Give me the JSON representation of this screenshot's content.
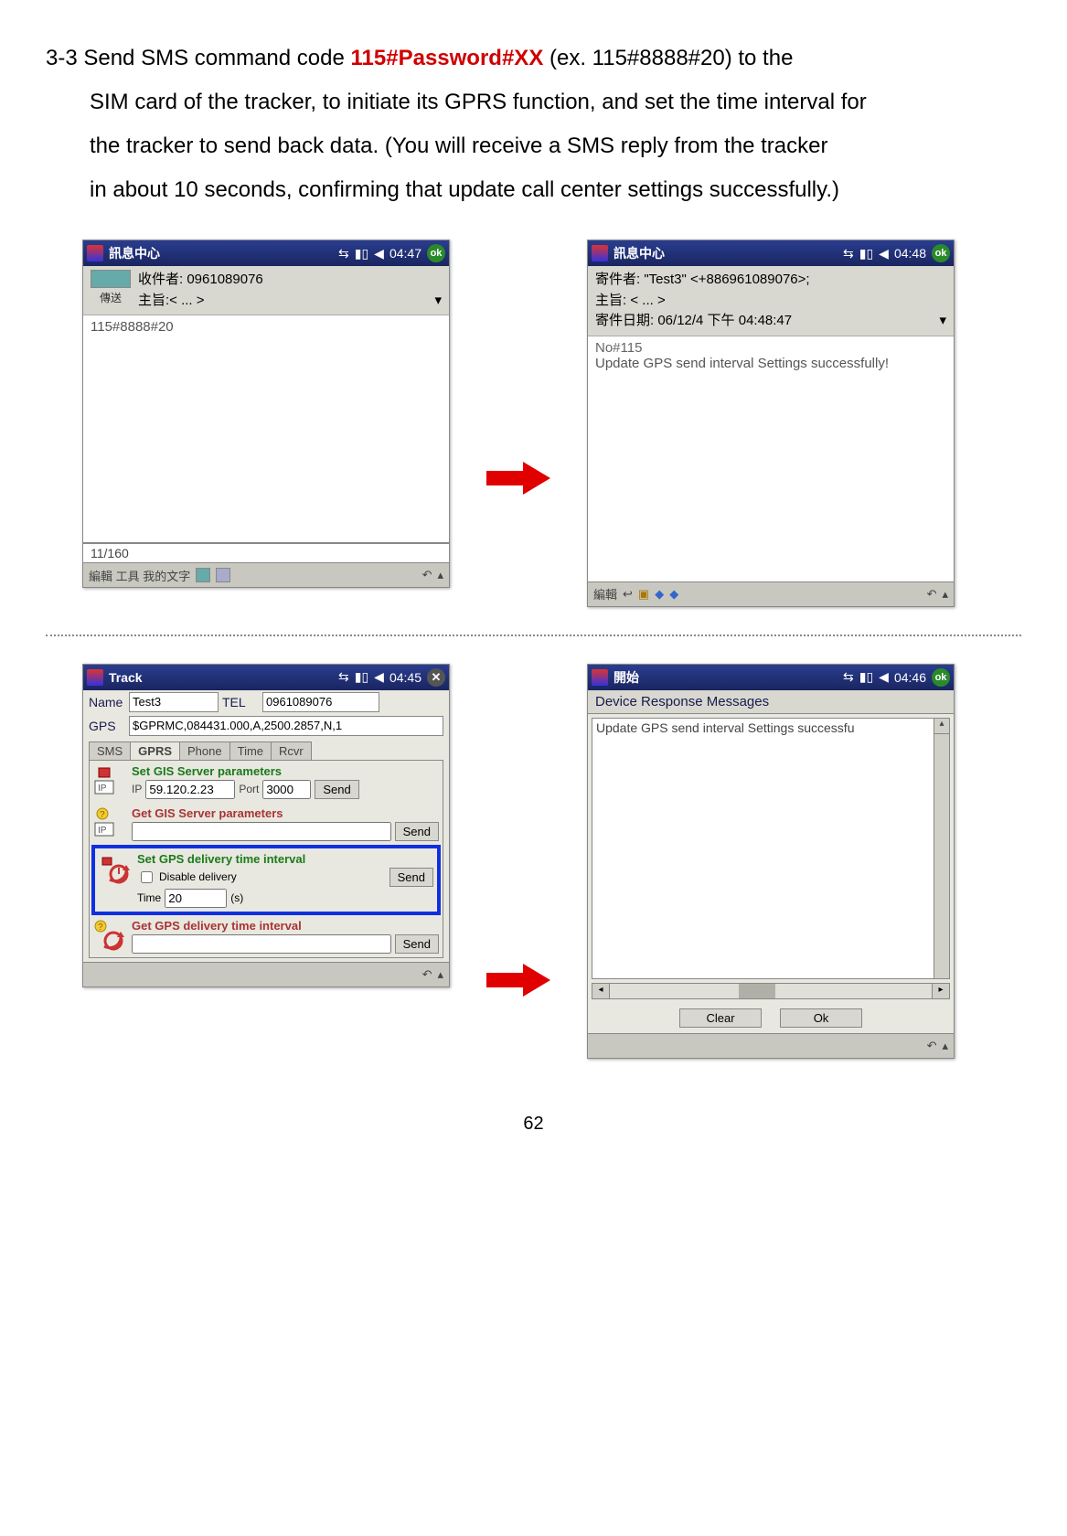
{
  "instruction": {
    "prefix": "3-3 Send SMS command code ",
    "command": "115#Password#XX",
    "line1_rest": " (ex. 115#8888#20) to the",
    "line2": "SIM card of the tracker, to initiate its GPRS function, and set the time interval for",
    "line3": "the tracker to send back data.    (You will receive a SMS reply from the tracker",
    "line4": "in about 10 seconds, confirming that update call center settings successfully.)"
  },
  "screen1": {
    "title": "訊息中心",
    "time": "04:47",
    "ok": "ok",
    "send_label": "傳送",
    "recipient_label": "收件者:",
    "recipient_value": "0961089076",
    "subject_label": "主旨:",
    "subject_value": "< ... >",
    "body": "115#8888#20",
    "count": "11/160",
    "footer": "編輯 工具 我的文字"
  },
  "screen2": {
    "title": "訊息中心",
    "time": "04:48",
    "ok": "ok",
    "from_label": "寄件者:",
    "from_value": "\"Test3\" <+886961089076>;",
    "subject_label": "主旨:",
    "subject_value": "< ... >",
    "date_label": "寄件日期:",
    "date_value": "06/12/4 下午 04:48:47",
    "body_line1": "No#115",
    "body_line2": "Update GPS send interval Settings successfully!",
    "footer": "編輯"
  },
  "screen3": {
    "title": "Track",
    "time": "04:45",
    "name_label": "Name",
    "name_value": "Test3",
    "tel_label": "TEL",
    "tel_value": "0961089076",
    "gps_label": "GPS",
    "gps_value": "$GPRMC,084431.000,A,2500.2857,N,1",
    "tabs": [
      "SMS",
      "GPRS",
      "Phone",
      "Time",
      "Rcvr"
    ],
    "active_tab": "GPRS",
    "group1": {
      "title": "Set GIS Server parameters",
      "ip_label": "IP",
      "ip_value": "59.120.2.23",
      "port_label": "Port",
      "port_value": "3000",
      "send": "Send"
    },
    "group2": {
      "title": "Get GIS Server parameters",
      "send": "Send"
    },
    "group3": {
      "title": "Set GPS delivery time interval",
      "disable": "Disable delivery",
      "time_label": "Time",
      "time_value": "20",
      "unit": "(s)",
      "send": "Send"
    },
    "group4": {
      "title": "Get GPS delivery time interval",
      "send": "Send"
    }
  },
  "screen4": {
    "title": "開始",
    "time": "04:46",
    "ok": "ok",
    "header": "Device Response Messages",
    "body": "Update GPS send interval Settings successfu",
    "clear": "Clear",
    "ok_btn": "Ok"
  },
  "page_number": "62"
}
